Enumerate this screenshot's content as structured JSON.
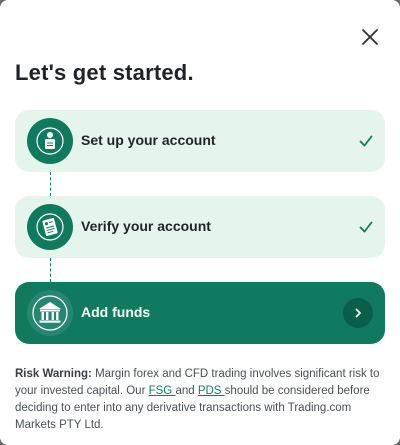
{
  "title": "Let's get started.",
  "steps": [
    {
      "label": "Set up your account",
      "status": "complete",
      "icon": "user-document-icon"
    },
    {
      "label": "Verify your account",
      "status": "complete",
      "icon": "id-document-icon"
    },
    {
      "label": "Add funds",
      "status": "current",
      "icon": "bank-icon"
    }
  ],
  "risk": {
    "bold": "Risk Warning:",
    "text1": " Margin forex and CFD trading involves significant risk to your invested capital. Our ",
    "link1": "FSG ",
    "text2": "and ",
    "link2": "PDS ",
    "text3": "should be considered before deciding to enter into any derivative transactions with Trading.com Markets PTY Ltd."
  },
  "colors": {
    "accent": "#0f7a5e",
    "done_bg": "#e6f4ee"
  }
}
